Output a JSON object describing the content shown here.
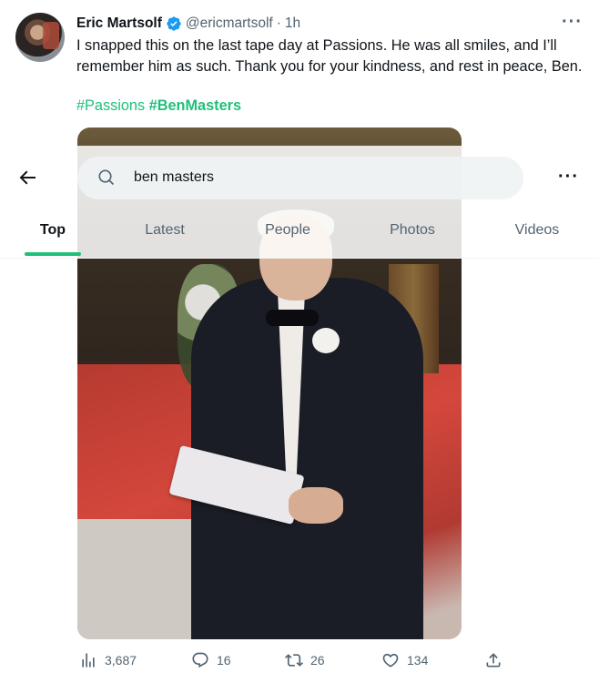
{
  "tweet": {
    "name": "Eric Martsolf",
    "handle": "@ericmartsolf",
    "separator": "·",
    "time": "1h",
    "text": "I snapped this on the last tape day at Passions.  He was all smiles, and I’ll remember him as such. Thank you for your kindness, and rest in peace, Ben.",
    "hashtags": [
      "#Passions",
      "#BenMasters"
    ],
    "more": "···"
  },
  "search": {
    "query": "ben masters",
    "more": "···",
    "tabs": [
      "Top",
      "Latest",
      "People",
      "Photos",
      "Videos"
    ],
    "active_tab": "Top"
  },
  "actions": {
    "views": "3,687",
    "replies": "16",
    "retweets": "26",
    "likes": "134"
  },
  "colors": {
    "accent": "#1fbf7a",
    "verified": "#1d9bf0",
    "muted": "#536471"
  }
}
